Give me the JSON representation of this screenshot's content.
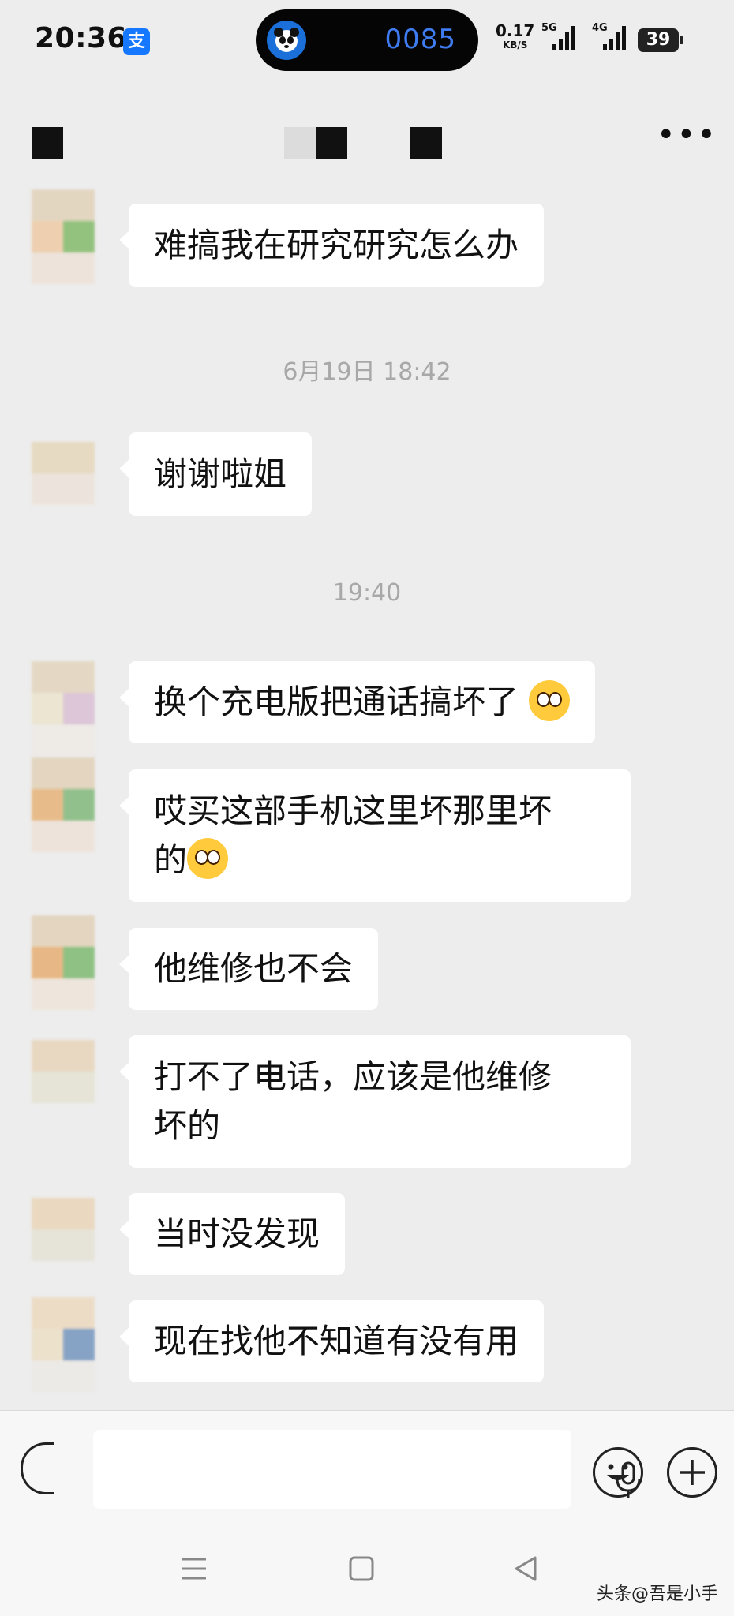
{
  "status_bar": {
    "time": "20:36",
    "island_number": "0085",
    "net_speed": "0.17",
    "net_unit": "KB/S",
    "sig1_label": "5G",
    "sig2_label": "4G",
    "battery": "39"
  },
  "messages": [
    {
      "text": "难搞我在研究研究怎么办"
    },
    {
      "timestamp": "6月19日 18:42"
    },
    {
      "text": "谢谢啦姐"
    },
    {
      "timestamp": "19:40"
    },
    {
      "text": "换个充电版把通话搞坏了",
      "emoji": "pleading-face-emoji"
    },
    {
      "text_line1": "哎买这部手机这里坏那里坏",
      "text_line2": "的",
      "emoji": "flushed-face-emoji"
    },
    {
      "text": "他维修也不会"
    },
    {
      "text_line1": "打不了电话，应该是他维修",
      "text_line2": "坏的"
    },
    {
      "text": "当时没发现"
    },
    {
      "text": "现在找他不知道有没有用"
    }
  ],
  "icons": [
    "more-icon",
    "voice-toggle-icon",
    "mic-icon",
    "emoji-icon",
    "plus-icon",
    "menu-nav-icon",
    "home-nav-icon",
    "back-nav-icon",
    "alipay-icon"
  ],
  "watermark": "头条@吾是小手",
  "colors": {
    "background": "#ededed",
    "bubble": "#ffffff",
    "island_text": "#3f7cf2",
    "alipay": "#1677ff"
  }
}
